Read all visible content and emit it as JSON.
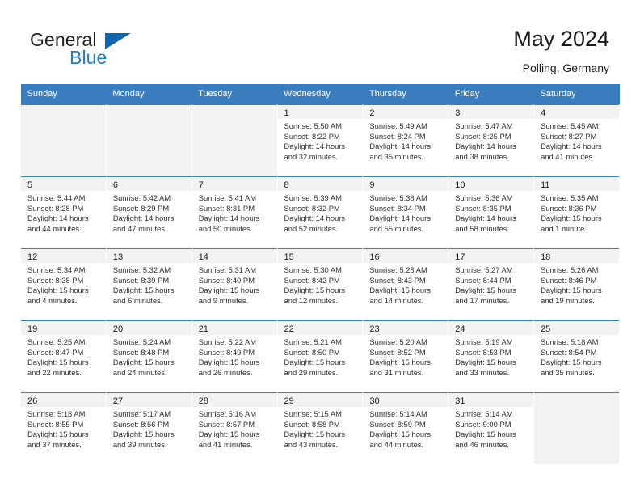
{
  "brand": {
    "word_one": "General",
    "word_two": "Blue",
    "logo_icon": "triangle-logo-icon",
    "accent_color": "#1f7cc4",
    "triangle_color": "#1064ab"
  },
  "header": {
    "title": "May 2024",
    "subtitle": "Polling, Germany"
  },
  "theme": {
    "header_bg": "#3b7cbf",
    "cell_header_bg": "#f2f2f2",
    "empty_cell_bg": "#f2f2f2",
    "text_color": "#303030"
  },
  "weekdays": [
    "Sunday",
    "Monday",
    "Tuesday",
    "Wednesday",
    "Thursday",
    "Friday",
    "Saturday"
  ],
  "labels": {
    "sunrise_prefix": "Sunrise:",
    "sunset_prefix": "Sunset:",
    "daylight_prefix": "Daylight:"
  },
  "weeks": [
    [
      {
        "empty": true
      },
      {
        "empty": true
      },
      {
        "empty": true
      },
      {
        "day": "1",
        "sunrise": "Sunrise: 5:50 AM",
        "sunset": "Sunset: 8:22 PM",
        "daylight1": "Daylight: 14 hours",
        "daylight2": "and 32 minutes."
      },
      {
        "day": "2",
        "sunrise": "Sunrise: 5:49 AM",
        "sunset": "Sunset: 8:24 PM",
        "daylight1": "Daylight: 14 hours",
        "daylight2": "and 35 minutes."
      },
      {
        "day": "3",
        "sunrise": "Sunrise: 5:47 AM",
        "sunset": "Sunset: 8:25 PM",
        "daylight1": "Daylight: 14 hours",
        "daylight2": "and 38 minutes."
      },
      {
        "day": "4",
        "sunrise": "Sunrise: 5:45 AM",
        "sunset": "Sunset: 8:27 PM",
        "daylight1": "Daylight: 14 hours",
        "daylight2": "and 41 minutes."
      }
    ],
    [
      {
        "day": "5",
        "sunrise": "Sunrise: 5:44 AM",
        "sunset": "Sunset: 8:28 PM",
        "daylight1": "Daylight: 14 hours",
        "daylight2": "and 44 minutes."
      },
      {
        "day": "6",
        "sunrise": "Sunrise: 5:42 AM",
        "sunset": "Sunset: 8:29 PM",
        "daylight1": "Daylight: 14 hours",
        "daylight2": "and 47 minutes."
      },
      {
        "day": "7",
        "sunrise": "Sunrise: 5:41 AM",
        "sunset": "Sunset: 8:31 PM",
        "daylight1": "Daylight: 14 hours",
        "daylight2": "and 50 minutes."
      },
      {
        "day": "8",
        "sunrise": "Sunrise: 5:39 AM",
        "sunset": "Sunset: 8:32 PM",
        "daylight1": "Daylight: 14 hours",
        "daylight2": "and 52 minutes."
      },
      {
        "day": "9",
        "sunrise": "Sunrise: 5:38 AM",
        "sunset": "Sunset: 8:34 PM",
        "daylight1": "Daylight: 14 hours",
        "daylight2": "and 55 minutes."
      },
      {
        "day": "10",
        "sunrise": "Sunrise: 5:36 AM",
        "sunset": "Sunset: 8:35 PM",
        "daylight1": "Daylight: 14 hours",
        "daylight2": "and 58 minutes."
      },
      {
        "day": "11",
        "sunrise": "Sunrise: 5:35 AM",
        "sunset": "Sunset: 8:36 PM",
        "daylight1": "Daylight: 15 hours",
        "daylight2": "and 1 minute."
      }
    ],
    [
      {
        "day": "12",
        "sunrise": "Sunrise: 5:34 AM",
        "sunset": "Sunset: 8:38 PM",
        "daylight1": "Daylight: 15 hours",
        "daylight2": "and 4 minutes."
      },
      {
        "day": "13",
        "sunrise": "Sunrise: 5:32 AM",
        "sunset": "Sunset: 8:39 PM",
        "daylight1": "Daylight: 15 hours",
        "daylight2": "and 6 minutes."
      },
      {
        "day": "14",
        "sunrise": "Sunrise: 5:31 AM",
        "sunset": "Sunset: 8:40 PM",
        "daylight1": "Daylight: 15 hours",
        "daylight2": "and 9 minutes."
      },
      {
        "day": "15",
        "sunrise": "Sunrise: 5:30 AM",
        "sunset": "Sunset: 8:42 PM",
        "daylight1": "Daylight: 15 hours",
        "daylight2": "and 12 minutes."
      },
      {
        "day": "16",
        "sunrise": "Sunrise: 5:28 AM",
        "sunset": "Sunset: 8:43 PM",
        "daylight1": "Daylight: 15 hours",
        "daylight2": "and 14 minutes."
      },
      {
        "day": "17",
        "sunrise": "Sunrise: 5:27 AM",
        "sunset": "Sunset: 8:44 PM",
        "daylight1": "Daylight: 15 hours",
        "daylight2": "and 17 minutes."
      },
      {
        "day": "18",
        "sunrise": "Sunrise: 5:26 AM",
        "sunset": "Sunset: 8:46 PM",
        "daylight1": "Daylight: 15 hours",
        "daylight2": "and 19 minutes."
      }
    ],
    [
      {
        "day": "19",
        "sunrise": "Sunrise: 5:25 AM",
        "sunset": "Sunset: 8:47 PM",
        "daylight1": "Daylight: 15 hours",
        "daylight2": "and 22 minutes."
      },
      {
        "day": "20",
        "sunrise": "Sunrise: 5:24 AM",
        "sunset": "Sunset: 8:48 PM",
        "daylight1": "Daylight: 15 hours",
        "daylight2": "and 24 minutes."
      },
      {
        "day": "21",
        "sunrise": "Sunrise: 5:22 AM",
        "sunset": "Sunset: 8:49 PM",
        "daylight1": "Daylight: 15 hours",
        "daylight2": "and 26 minutes."
      },
      {
        "day": "22",
        "sunrise": "Sunrise: 5:21 AM",
        "sunset": "Sunset: 8:50 PM",
        "daylight1": "Daylight: 15 hours",
        "daylight2": "and 29 minutes."
      },
      {
        "day": "23",
        "sunrise": "Sunrise: 5:20 AM",
        "sunset": "Sunset: 8:52 PM",
        "daylight1": "Daylight: 15 hours",
        "daylight2": "and 31 minutes."
      },
      {
        "day": "24",
        "sunrise": "Sunrise: 5:19 AM",
        "sunset": "Sunset: 8:53 PM",
        "daylight1": "Daylight: 15 hours",
        "daylight2": "and 33 minutes."
      },
      {
        "day": "25",
        "sunrise": "Sunrise: 5:18 AM",
        "sunset": "Sunset: 8:54 PM",
        "daylight1": "Daylight: 15 hours",
        "daylight2": "and 35 minutes."
      }
    ],
    [
      {
        "day": "26",
        "sunrise": "Sunrise: 5:18 AM",
        "sunset": "Sunset: 8:55 PM",
        "daylight1": "Daylight: 15 hours",
        "daylight2": "and 37 minutes."
      },
      {
        "day": "27",
        "sunrise": "Sunrise: 5:17 AM",
        "sunset": "Sunset: 8:56 PM",
        "daylight1": "Daylight: 15 hours",
        "daylight2": "and 39 minutes."
      },
      {
        "day": "28",
        "sunrise": "Sunrise: 5:16 AM",
        "sunset": "Sunset: 8:57 PM",
        "daylight1": "Daylight: 15 hours",
        "daylight2": "and 41 minutes."
      },
      {
        "day": "29",
        "sunrise": "Sunrise: 5:15 AM",
        "sunset": "Sunset: 8:58 PM",
        "daylight1": "Daylight: 15 hours",
        "daylight2": "and 43 minutes."
      },
      {
        "day": "30",
        "sunrise": "Sunrise: 5:14 AM",
        "sunset": "Sunset: 8:59 PM",
        "daylight1": "Daylight: 15 hours",
        "daylight2": "and 44 minutes."
      },
      {
        "day": "31",
        "sunrise": "Sunrise: 5:14 AM",
        "sunset": "Sunset: 9:00 PM",
        "daylight1": "Daylight: 15 hours",
        "daylight2": "and 46 minutes."
      },
      {
        "empty": true
      }
    ]
  ]
}
